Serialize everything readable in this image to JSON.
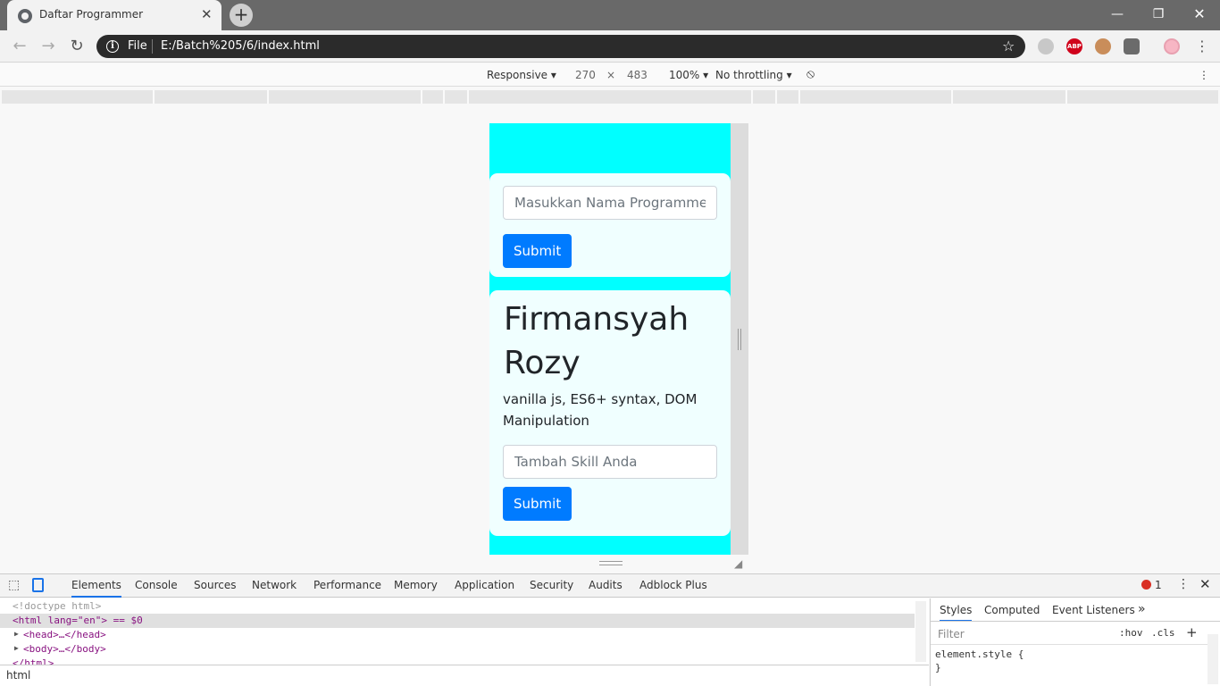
{
  "browser": {
    "tab_title": "Daftar Programmer",
    "address_scheme_label": "File",
    "url": "E:/Batch%205/6/index.html"
  },
  "device_toolbar": {
    "device": "Responsive",
    "width": "270",
    "times": "×",
    "height": "483",
    "zoom": "100%",
    "throttling": "No throttling"
  },
  "page": {
    "background_color": "#00ffff",
    "card_color": "#f0ffff",
    "button_color": "#007bff",
    "programmer_input_placeholder": "Masukkan Nama Programmer...",
    "submit_label": "Submit",
    "programmer_name": "Firmansyah Rozy",
    "programmer_skills": "vanilla js, ES6+ syntax, DOM Manipulation",
    "skill_input_placeholder": "Tambah Skill Anda",
    "skill_submit_label": "Submit"
  },
  "devtools": {
    "tabs": [
      "Elements",
      "Console",
      "Sources",
      "Network",
      "Performance",
      "Memory",
      "Application",
      "Security",
      "Audits",
      "Adblock Plus"
    ],
    "error_count": "1",
    "dom_lines": {
      "doctype": "<!doctype html>",
      "html_open": "<html lang=\"en\"> == $0",
      "head": "<head>…</head>",
      "body": "<body>…</body>",
      "html_close": "</html>"
    },
    "breadcrumb": "html",
    "styles_tabs": [
      "Styles",
      "Computed",
      "Event Listeners"
    ],
    "styles_more": "»",
    "filter_placeholder": "Filter",
    "hov": ":hov",
    "cls": ".cls",
    "add": "+",
    "element_style_open": "element.style {",
    "element_style_close": "}"
  }
}
